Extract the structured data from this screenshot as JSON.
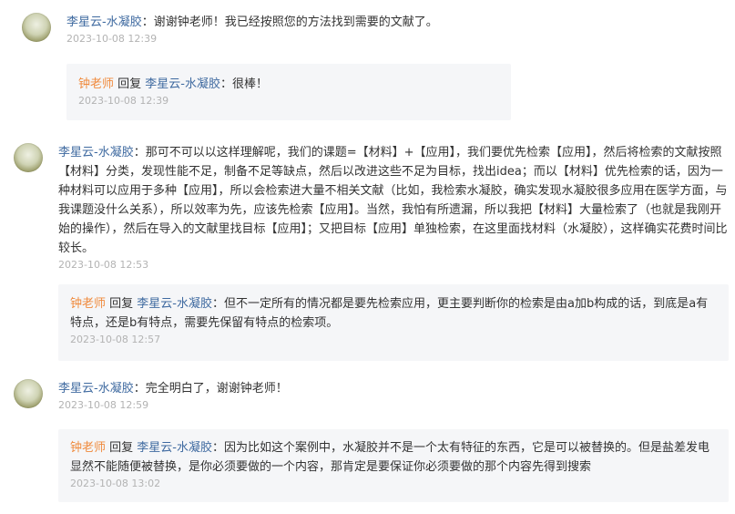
{
  "comments": [
    {
      "author": "李星云-水凝胶",
      "sep": "：",
      "text": "谢谢钟老师！我已经按照您的方法找到需要的文献了。",
      "time": "2023-10-08 12:39",
      "reply": {
        "from": "钟老师",
        "reply_word": " 回复 ",
        "to": "李星云-水凝胶",
        "sep": "：",
        "text": "很棒！",
        "time": "2023-10-08 12:39"
      }
    },
    {
      "author": "李星云-水凝胶",
      "sep": "：",
      "text": "那可不可以以这样理解呢，我们的课题=【材料】+【应用】，我们要优先检索【应用】，然后将检索的文献按照【材料】分类，发现性能不足，制备不足等缺点，然后以改进这些不足为目标，找出idea；而以【材料】优先检索的话，因为一种材料可以应用于多种【应用】，所以会检索进大量不相关文献（比如，我检索水凝胶，确实发现水凝胶很多应用在医学方面，与我课题没什么关系），所以效率为先，应该先检索【应用】。当然，我怕有所遗漏，所以我把【材料】大量检索了（也就是我刚开始的操作），然后在导入的文献里找目标【应用】；又把目标【应用】单独检索，在这里面找材料（水凝胶），这样确实花费时间比较长。",
      "time": "2023-10-08 12:53",
      "reply": {
        "from": "钟老师",
        "reply_word": " 回复 ",
        "to": "李星云-水凝胶",
        "sep": "：",
        "text": "但不一定所有的情况都是要先检索应用，更主要判断你的检索是由a加b构成的话，到底是a有特点，还是b有特点，需要先保留有特点的检索项。",
        "time": "2023-10-08 12:57"
      }
    },
    {
      "author": "李星云-水凝胶",
      "sep": "：",
      "text": "完全明白了，谢谢钟老师！",
      "time": "2023-10-08 12:59",
      "reply": {
        "from": "钟老师",
        "reply_word": " 回复 ",
        "to": "李星云-水凝胶",
        "sep": "：",
        "text": "因为比如这个案例中，水凝胶并不是一个太有特征的东西，它是可以被替换的。但是盐差发电显然不能随便被替换，是你必须要做的一个内容，那肯定是要保证你必须要做的那个内容先得到搜索",
        "time": "2023-10-08 13:02"
      }
    }
  ]
}
